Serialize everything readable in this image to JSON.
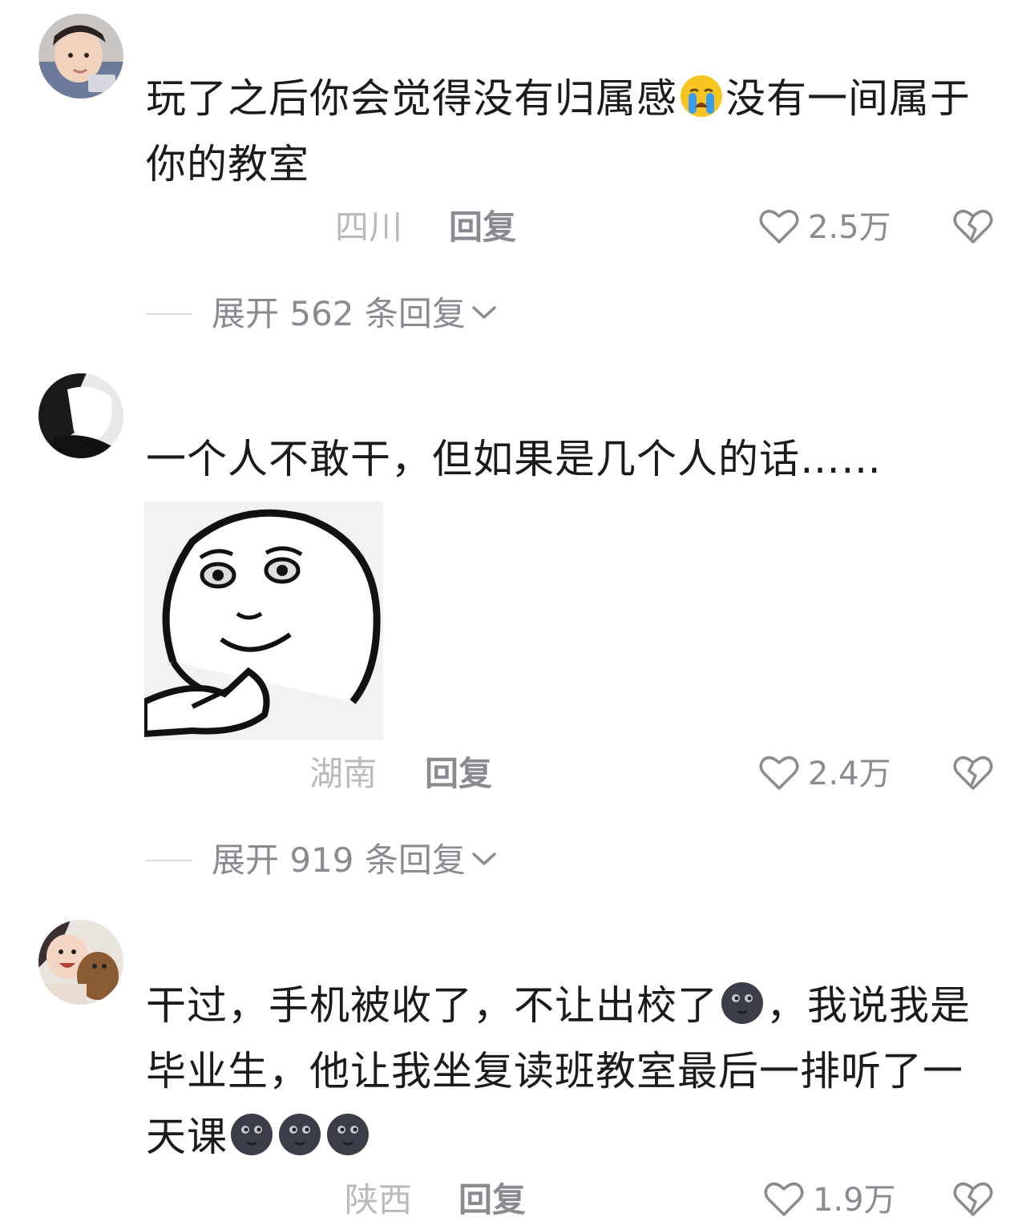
{
  "comments": [
    {
      "text_part1": "玩了之后你会觉得没有归属感",
      "emoji1": "loudly-crying-face",
      "text_part2": "没有一间属于你的教室",
      "location": "四川",
      "reply_label": "回复",
      "likes": "2.5万",
      "expand_label": "展开 562 条回复"
    },
    {
      "text": "一个人不敢干，但如果是几个人的话……",
      "sticker": "meme-face-sticker",
      "location": "湖南",
      "reply_label": "回复",
      "likes": "2.4万",
      "expand_label": "展开 919 条回复"
    },
    {
      "text_part1": "干过，手机被收了，不让出校了",
      "emoji1": "new-moon-face",
      "text_part2": "，我说我是毕业生，他让我坐复读班教室最后一排听了一天课",
      "emoji_trailing": [
        "new-moon-face",
        "new-moon-face",
        "new-moon-face"
      ],
      "location": "陕西",
      "reply_label": "回复",
      "likes": "1.9万"
    }
  ],
  "colors": {
    "text": "#1b1b1b",
    "muted": "#8a8a90",
    "location": "#b9b9be"
  },
  "icons": {
    "like": "heart-outline-icon",
    "dislike": "broken-heart-icon",
    "expand": "chevron-down-icon"
  }
}
